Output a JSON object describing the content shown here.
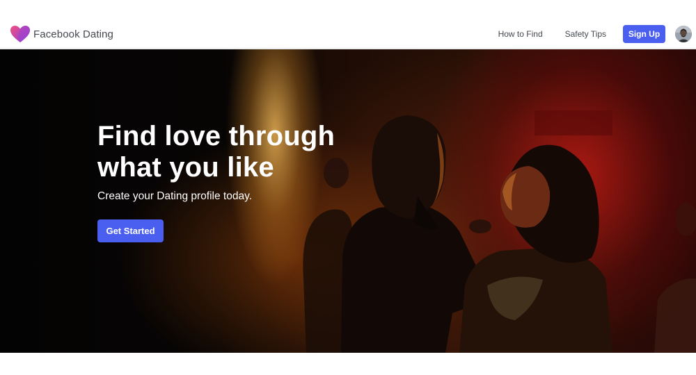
{
  "brand": {
    "name": "Facebook Dating",
    "logo_icon": "heart-logo-icon",
    "gradient": [
      "#e94a8d",
      "#8a3ce0"
    ]
  },
  "nav": {
    "links": [
      {
        "label": "How to Find"
      },
      {
        "label": "Safety Tips"
      }
    ],
    "signup_label": "Sign Up",
    "avatar_icon": "user-avatar"
  },
  "hero": {
    "title_line1": "Find love through",
    "title_line2": "what you like",
    "subtitle": "Create your Dating profile today.",
    "cta_label": "Get Started",
    "background_image": "couple dancing in a dim club with warm orange and red lights"
  },
  "colors": {
    "accent": "#4a5ef0",
    "nav_text": "#444950",
    "hero_text": "#ffffff"
  }
}
